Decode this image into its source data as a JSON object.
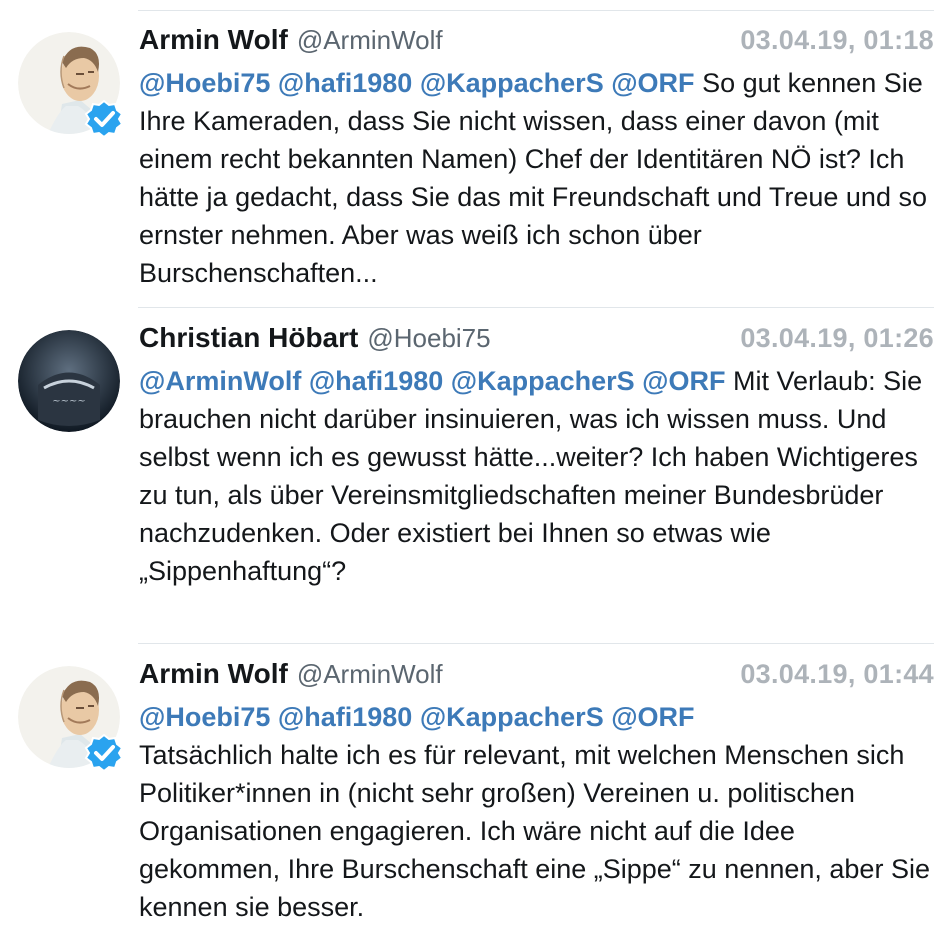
{
  "colors": {
    "mention": "#3d7ab8",
    "date": "#adb3b9",
    "handle": "#5b6670",
    "verified": "#2aa3ef"
  },
  "tweets": [
    {
      "name": "Armin Wolf",
      "handle": "@ArminWolf",
      "date": "03.04.19, 01:18",
      "verified": true,
      "avatar_icon": "portrait-sketch",
      "mentions": [
        "@Hoebi75",
        "@hafi1980",
        "@KappacherS",
        "@ORF"
      ],
      "text": "So gut kennen Sie Ihre Kameraden, dass Sie nicht wissen, dass einer davon (mit einem recht bekannten Namen) Chef der Identitären NÖ ist? Ich hätte ja gedacht, dass Sie das mit Freundschaft und Treue und so ernster nehmen. Aber was weiß ich schon über Burschenschaften..."
    },
    {
      "name": "Christian Höbart",
      "handle": "@Hoebi75",
      "date": "03.04.19, 01:26",
      "verified": false,
      "avatar_icon": "dark-photo",
      "mentions": [
        "@ArminWolf",
        "@hafi1980",
        "@KappacherS",
        "@ORF"
      ],
      "text": "Mit Verlaub: Sie brauchen nicht darüber insinuieren, was ich wissen muss. Und selbst wenn ich es gewusst hätte...weiter? Ich haben Wichtigeres zu tun, als über Vereinsmitgliedschaften meiner Bundesbrüder nachzudenken. Oder existiert bei Ihnen so etwas wie „Sippenhaftung“?"
    },
    {
      "name": "Armin Wolf",
      "handle": "@ArminWolf",
      "date": "03.04.19, 01:44",
      "verified": true,
      "avatar_icon": "portrait-sketch",
      "mentions": [
        "@Hoebi75",
        "@hafi1980",
        "@KappacherS",
        "@ORF"
      ],
      "text": "Tatsächlich halte ich es für relevant, mit welchen Menschen sich Politiker*innen in (nicht sehr großen) Vereinen u. politischen Organisationen engagieren. Ich wäre nicht auf die Idee gekommen, Ihre Burschenschaft eine „Sippe“ zu nennen, aber Sie kennen sie besser."
    }
  ]
}
